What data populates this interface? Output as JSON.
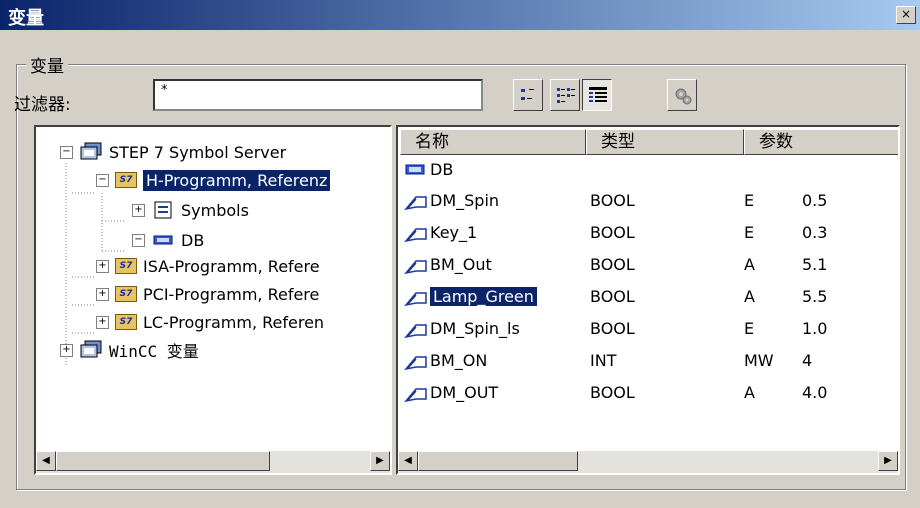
{
  "window": {
    "title": "变量",
    "close_label": "×"
  },
  "group": {
    "label": "变量"
  },
  "filter": {
    "label": "过滤器:",
    "value": "*"
  },
  "tree": {
    "items": [
      {
        "label": "STEP 7 Symbol Server",
        "expander": "−"
      },
      {
        "label": "H-Programm,  Referenz",
        "badge": "S7",
        "expander": "−"
      },
      {
        "label": "Symbols",
        "expander": "+"
      },
      {
        "label": "DB",
        "expander": "−"
      },
      {
        "label": "ISA-Programm, Refere",
        "badge": "S7",
        "expander": "+"
      },
      {
        "label": "PCI-Programm, Refere",
        "badge": "S7",
        "expander": "+"
      },
      {
        "label": "LC-Programm, Referen",
        "badge": "S7",
        "expander": "+"
      },
      {
        "label": "WinCC 变量",
        "expander": "+"
      }
    ]
  },
  "list": {
    "columns": [
      "名称",
      "类型",
      "参数"
    ],
    "db_label": "DB",
    "rows": [
      {
        "name": "DM_Spin",
        "type": "BOOL",
        "p1": "E",
        "p2": "0.5"
      },
      {
        "name": "Key_1",
        "type": "BOOL",
        "p1": "E",
        "p2": "0.3"
      },
      {
        "name": "BM_Out",
        "type": "BOOL",
        "p1": "A",
        "p2": "5.1"
      },
      {
        "name": "Lamp_Green",
        "type": "BOOL",
        "p1": "A",
        "p2": "5.5"
      },
      {
        "name": "DM_Spin_ls",
        "type": "BOOL",
        "p1": "E",
        "p2": "1.0"
      },
      {
        "name": "BM_ON",
        "type": "INT",
        "p1": "MW",
        "p2": "4"
      },
      {
        "name": "DM_OUT",
        "type": "BOOL",
        "p1": "A",
        "p2": "4.0"
      }
    ]
  },
  "scroll": {
    "left_arrow": "◀",
    "right_arrow": "▶"
  }
}
